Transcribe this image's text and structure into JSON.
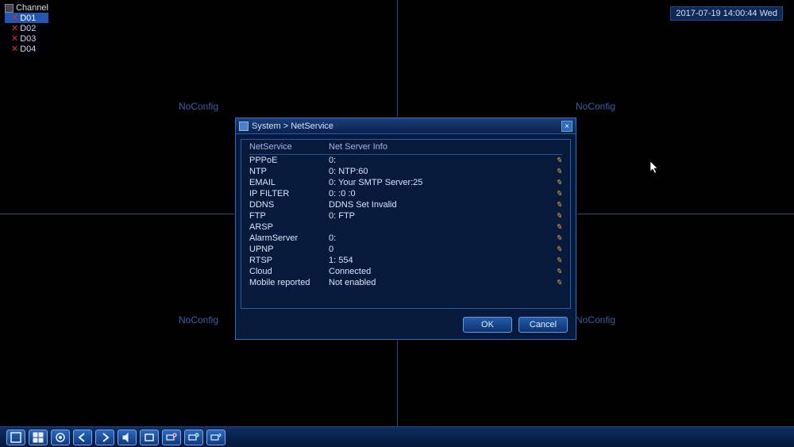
{
  "channel_label": "Channel",
  "channels": [
    "D01",
    "D02",
    "D03",
    "D04"
  ],
  "selected_channel": 0,
  "quad_label": "NoConfig",
  "timestamp": "2017-07-19 14:00:44 Wed",
  "dialog": {
    "title": "System > NetService",
    "col1": "NetService",
    "col2": "Net Server Info",
    "rows": [
      {
        "name": "PPPoE",
        "info": "0:"
      },
      {
        "name": "NTP",
        "info": "0: NTP:60"
      },
      {
        "name": "EMAIL",
        "info": "0: Your SMTP Server:25"
      },
      {
        "name": "IP FILTER",
        "info": "0: :0 :0"
      },
      {
        "name": "DDNS",
        "info": "DDNS Set Invalid"
      },
      {
        "name": "FTP",
        "info": "0: FTP"
      },
      {
        "name": "ARSP",
        "info": ""
      },
      {
        "name": "AlarmServer",
        "info": "0:"
      },
      {
        "name": "UPNP",
        "info": "0"
      },
      {
        "name": "RTSP",
        "info": "1: 554"
      },
      {
        "name": "Cloud",
        "info": "Connected"
      },
      {
        "name": "Mobile reported",
        "info": "Not enabled"
      }
    ],
    "ok": "OK",
    "cancel": "Cancel"
  },
  "toolbar": {
    "items": [
      "single-view",
      "multi-view",
      "ptz",
      "prev",
      "next",
      "volume",
      "color",
      "record-on",
      "record-off",
      "snapshot"
    ]
  }
}
